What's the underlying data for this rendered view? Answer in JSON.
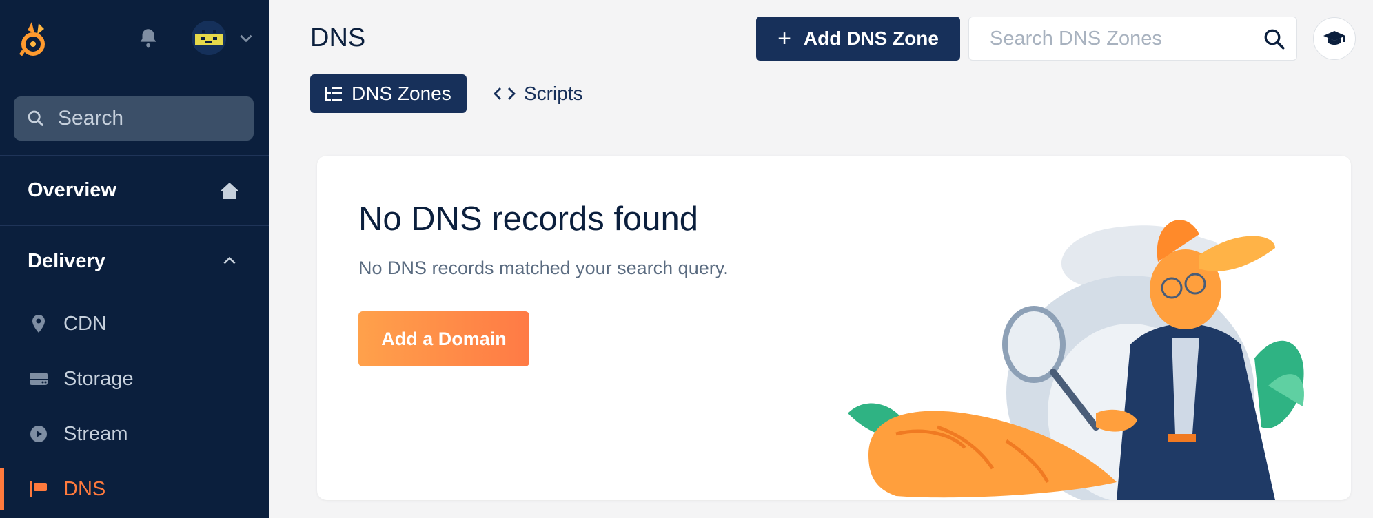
{
  "sidebar": {
    "search_label": "Search",
    "overview_label": "Overview",
    "delivery_label": "Delivery",
    "items": [
      {
        "label": "CDN",
        "icon": "location-pin-icon"
      },
      {
        "label": "Storage",
        "icon": "drive-icon"
      },
      {
        "label": "Stream",
        "icon": "play-icon"
      },
      {
        "label": "DNS",
        "icon": "flag-icon",
        "active": true
      }
    ]
  },
  "header": {
    "title": "DNS",
    "add_zone_label": "Add DNS Zone",
    "search_placeholder": "Search DNS Zones",
    "tabs": [
      {
        "label": "DNS Zones",
        "active": true
      },
      {
        "label": "Scripts",
        "active": false
      }
    ]
  },
  "empty_state": {
    "heading": "No DNS records found",
    "description": "No DNS records matched your search query.",
    "button_label": "Add a Domain"
  },
  "colors": {
    "sidebar_bg": "#0b1f3d",
    "primary": "#17305a",
    "accent": "#ff7a3d"
  }
}
